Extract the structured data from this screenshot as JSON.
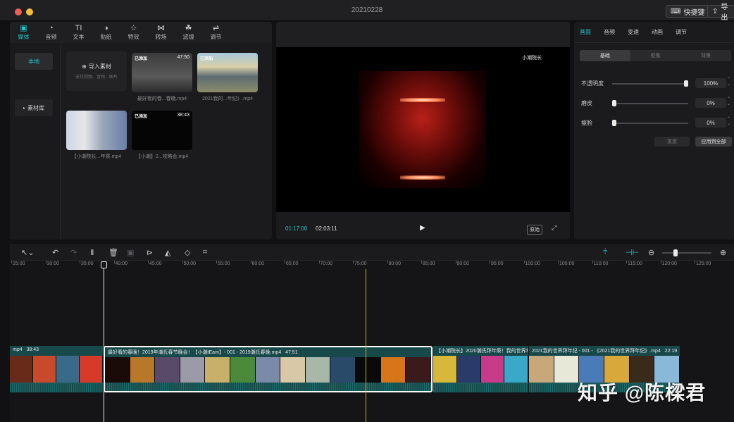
{
  "window": {
    "title": "20210228",
    "shortcut_label": "快捷键",
    "export_label": "导出"
  },
  "media_tabs": [
    {
      "label": "媒体",
      "icon": "▣",
      "active": true
    },
    {
      "label": "音频",
      "icon": "◔"
    },
    {
      "label": "文本",
      "icon": "TI"
    },
    {
      "label": "贴纸",
      "icon": "◑"
    },
    {
      "label": "特效",
      "icon": "☆"
    },
    {
      "label": "转场",
      "icon": "⋈"
    },
    {
      "label": "滤镜",
      "icon": "☘"
    },
    {
      "label": "调节",
      "icon": "⇌"
    }
  ],
  "side": {
    "local": "本地",
    "library": "素材库"
  },
  "import": {
    "label": "导入素材",
    "hint": "支持视频、音频、图片"
  },
  "clips": [
    {
      "tag": "已添加",
      "duration": "47:50",
      "caption": "最好看的春...春晚.mp4"
    },
    {
      "tag": "已添加",
      "duration": "",
      "caption": "2021我的...年纪》.mp4"
    },
    {
      "tag": "",
      "duration": "",
      "caption": "【小潮院长...年祭.mp4"
    },
    {
      "tag": "已添加",
      "duration": "38:43",
      "caption": "【小潮】2...攻略会.mp4"
    }
  ],
  "player": {
    "brand": "小潮院长",
    "current": "01:17:00",
    "total": "02:03:11",
    "ratio": "原始"
  },
  "inspector": {
    "tabs": [
      "画面",
      "音频",
      "变速",
      "动画",
      "调节"
    ],
    "segments": [
      "基础",
      "抠像",
      "背景"
    ],
    "opacity_label": "不透明度",
    "opacity_value": "100%",
    "opacity_level": 1.0,
    "smooth_label": "磨皮",
    "smooth_value": "0%",
    "smooth_level": 0,
    "slim_label": "瘦脸",
    "slim_value": "0%",
    "slim_level": 0,
    "reset_label": "重置",
    "apply_all_label": "应用到全部"
  },
  "ruler_ticks": [
    "25:00",
    "30:00",
    "35:00",
    "40:00",
    "45:00",
    "50:00",
    "55:00",
    "60:00",
    "65:00",
    "70:00",
    "75:00",
    "80:00",
    "85:00",
    "90:00",
    "95:00",
    "100:00",
    "105:00",
    "110:00",
    "115:00",
    "120:00",
    "125:00"
  ],
  "track": {
    "clip1": {
      "label": "mp4",
      "duration": "38:43"
    },
    "clip2": {
      "label": "最好看的春晚！2019年潮氏春节晚会！【小潮tEam】- 001 - 2019潮氏春晚.mp4",
      "duration": "47:51"
    },
    "clip3": {
      "label": "【小潮院长】2020潮氏拜年祭！我的世界拳",
      "duration": ""
    },
    "clip4": {
      "label": "2021我的世界拜年纪 - 001 - 《2021我的世界拜年纪》.mp4",
      "duration": "22:19"
    }
  },
  "watermark": "知乎 @陈樑君",
  "colors": {
    "accent": "#22c3c8",
    "playhead": "#c8b400"
  }
}
